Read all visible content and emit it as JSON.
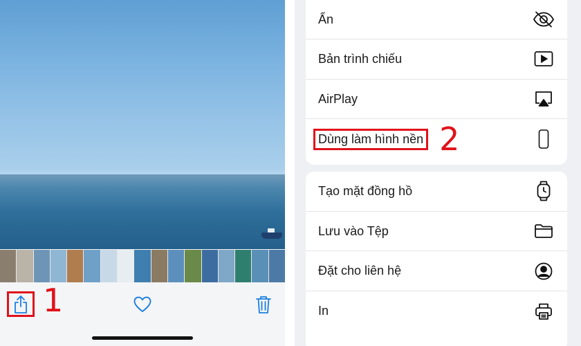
{
  "viewer": {
    "thumbnails": [
      "#8a7f6f",
      "#b9b3a8",
      "#6e95b5",
      "#8fb6d3",
      "#b07d4f",
      "#6fa0c8",
      "#c7d9e6",
      "#e8edf1",
      "#3f7fb0",
      "#8b7b63",
      "#5d8fbd",
      "#6a8a4a",
      "#3d6da0",
      "#7fa7c8",
      "#2f7f6f",
      "#5a8fb6",
      "#4d79a6"
    ],
    "toolbar": {
      "share_icon": "share-icon",
      "favorite_icon": "heart-icon",
      "delete_icon": "trash-icon",
      "callout": "1"
    }
  },
  "share_sheet": {
    "group1": [
      {
        "label": "Ẩn",
        "icon": "eye-slash-icon"
      },
      {
        "label": "Bản trình chiếu",
        "icon": "play-icon"
      },
      {
        "label": "AirPlay",
        "icon": "airplay-icon"
      },
      {
        "label": "Dùng làm hình nền",
        "icon": "phone-icon",
        "callout": "2"
      }
    ],
    "group2": [
      {
        "label": "Tạo mặt đồng hồ",
        "icon": "watch-icon"
      },
      {
        "label": "Lưu vào Tệp",
        "icon": "folder-icon"
      },
      {
        "label": "Đặt cho liên hệ",
        "icon": "contact-icon"
      },
      {
        "label": "In",
        "icon": "printer-icon"
      }
    ]
  },
  "colors": {
    "accent_red": "#e0121b",
    "ios_blue": "#1a7fe0"
  }
}
